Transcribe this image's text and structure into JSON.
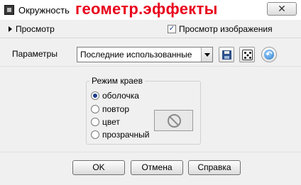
{
  "window": {
    "title": "Окружность",
    "overlay_title": "геометр.эффекты",
    "close_glyph": "✕"
  },
  "preview": {
    "expander_label": "Просмотр",
    "image_preview_checkbox": {
      "label": "Просмотр изображения",
      "checked": true,
      "glyph": "✓"
    }
  },
  "params": {
    "label": "Параметры",
    "preset_value": "Последние использованные",
    "save_icon": "floppy-disk-icon",
    "random_icon": "dice-icon",
    "reset_icon": "reset-icon"
  },
  "edge_mode": {
    "title": "Режим краев",
    "options": [
      {
        "label": "оболочка",
        "selected": true
      },
      {
        "label": "повтор",
        "selected": false
      },
      {
        "label": "цвет",
        "selected": false
      },
      {
        "label": "прозрачный",
        "selected": false
      }
    ]
  },
  "buttons": {
    "ok": "OK",
    "cancel": "Отмена",
    "help": "Справка"
  }
}
